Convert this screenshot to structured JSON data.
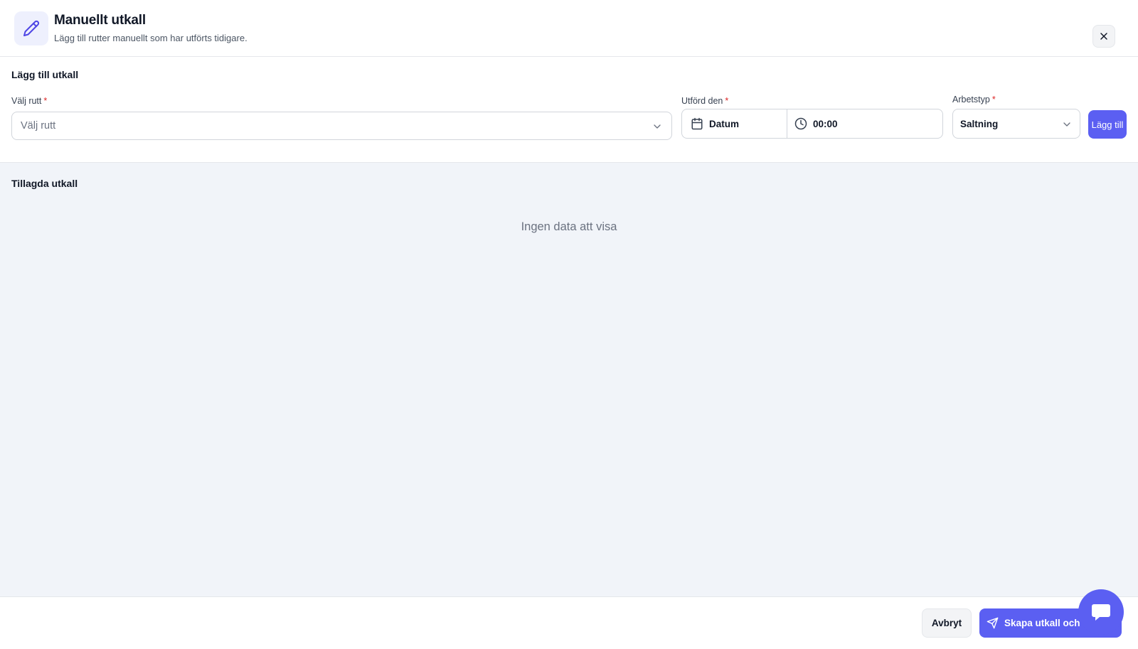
{
  "header": {
    "title": "Manuellt utkall",
    "subtitle": "Lägg till rutter manuellt som har utförts tidigare.",
    "icon": "pencil-icon"
  },
  "add_section": {
    "title": "Lägg till utkall",
    "route_label": "Välj rutt",
    "route_placeholder": "Välj rutt",
    "performed_label": "Utförd den",
    "date_value": "Datum",
    "time_value": "00:00",
    "worktype_label": "Arbetstyp",
    "worktype_value": "Saltning",
    "required_mark": "*",
    "add_button": "Lägg till"
  },
  "list_section": {
    "title": "Tillagda utkall",
    "empty_text": "Ingen data att visa"
  },
  "footer": {
    "cancel_button": "Avbryt",
    "create_button": "Skapa utkall och fa"
  },
  "colors": {
    "accent": "#5b5ff2",
    "required": "#dc2626",
    "panel_bg": "#f1f4f9"
  }
}
